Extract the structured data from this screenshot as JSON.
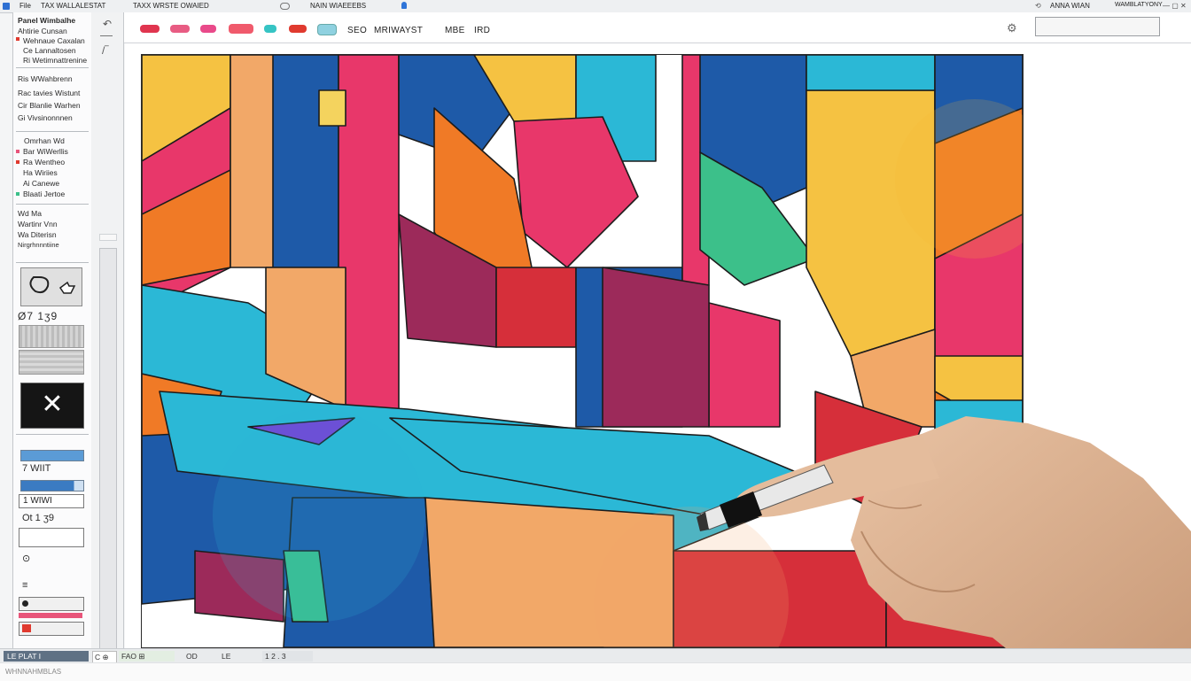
{
  "titlebar": {
    "menu_a": "File",
    "menu_b": "ТАХ  WALLALESTAT",
    "menu_c": "TAXX  WRSTE  OWAIED",
    "doc_title": "NAIN  WIAEEEBS",
    "right_a": "ANNA  WIAN",
    "right_b": "WAMBLATYONY",
    "win_controls": "— ▢ ✕"
  },
  "left_panel": {
    "header": "Panel Wimbalhe",
    "layers": [
      "Ahtirie  Cunsan",
      "Wehnaue Caxalan",
      "Ce  Lannaltosen",
      "Ri  Wetimnattrenine",
      "Ris  WWahbrenn",
      "Rac  tavies Wistunt",
      "Cir  Blanlie Warhen",
      "Gi  Vivsinonnnen"
    ],
    "group_header": "Omrhan  Wd",
    "group_items": [
      "Bar  WiWerllis",
      "Ra  Wentheo",
      "Ha  Wiriies",
      "Ai  Canewe",
      "Blaati  Jertoe"
    ],
    "props": [
      "Wd   Ma",
      "Wartinr  Vnn",
      "Wa  Diterisn",
      "Nirgrhnnntiine"
    ],
    "numeric_row": "Ø7  1ʒ9",
    "bar_row_label": "7  WIIT",
    "bar_row_label_2": "1  WIWI",
    "bar_row_label_3": "Ot  1  ʒ9",
    "small_labels": [
      "⊙",
      "≡"
    ],
    "colors": {
      "accent_blue": "#5b9bd6",
      "red": "#e03a2f",
      "pink": "#e8547a"
    }
  },
  "toolbar": {
    "brush_colors": [
      "#e0354f",
      "#e85c83",
      "#e94a8a",
      "#f05a6c",
      "#36c4c4",
      "#e03a2f",
      "#8fd1e0"
    ],
    "label_a": "SEO",
    "label_b": "MRIWAYST",
    "label_c": "MBE",
    "label_d": "IRD",
    "search_placeholder": ""
  },
  "statusbar": {
    "seg_a": "LE  PLAT  Ⅰ",
    "seg_b": "C  ⊕",
    "seg_c": "FAO  ⊞",
    "seg_d": "OD",
    "seg_e": "LE",
    "seg_f": "1 2 . 3"
  },
  "footer": {
    "text": "WHNNAHMBLAS"
  },
  "canvas": {
    "palette": [
      "#f5c242",
      "#e8376a",
      "#1e5aa8",
      "#f07a26",
      "#2bb8d6",
      "#f2a868",
      "#d62f3a",
      "#9c2a5a",
      "#3cc08a",
      "#7a3ad6",
      "#f4d35e"
    ]
  }
}
